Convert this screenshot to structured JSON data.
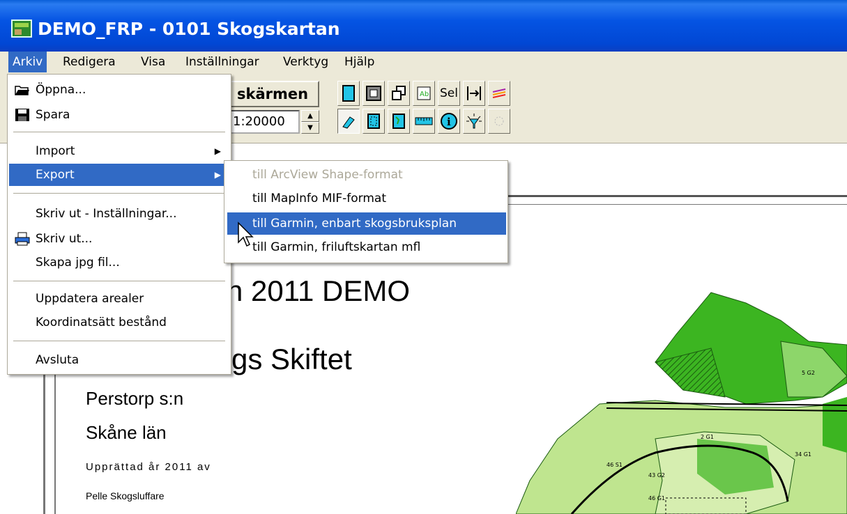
{
  "window": {
    "title": "DEMO_FRP - 0101 Skogskartan"
  },
  "menubar": {
    "items": [
      {
        "label": "Arkiv"
      },
      {
        "label": "Redigera"
      },
      {
        "label": "Visa"
      },
      {
        "label": "Inställningar"
      },
      {
        "label": "Verktyg"
      },
      {
        "label": "Hjälp"
      }
    ]
  },
  "toolbar": {
    "big_button_label": "skärmen",
    "scale_value": "1:20000",
    "sel_label": "Sel"
  },
  "arkiv_menu": {
    "items": [
      {
        "label": "Öppna..."
      },
      {
        "label": "Spara"
      },
      {
        "label": "Import"
      },
      {
        "label": "Export"
      },
      {
        "label": "Skriv ut - Inställningar..."
      },
      {
        "label": "Skriv ut..."
      },
      {
        "label": "Skapa jpg fil..."
      },
      {
        "label": "Uppdatera arealer"
      },
      {
        "label": "Koordinatsätt bestånd"
      },
      {
        "label": "Avsluta"
      }
    ]
  },
  "export_submenu": {
    "items": [
      {
        "label": "till ArcView Shape-format"
      },
      {
        "label": "till MapInfo MIF-format"
      },
      {
        "label": "till Garmin, enbart skogsbruksplan"
      },
      {
        "label": "till Garmin, friluftskartan mfl"
      }
    ]
  },
  "map": {
    "heading1": "n 2011 DEMO",
    "heading2": "gs Skiftet",
    "parish": "Perstorp s:n",
    "county": "Skåne län",
    "prepared": "Upprättad år 2011 av",
    "author": "Pelle Skogsluffare"
  },
  "colors": {
    "titlebar": "#0554e3",
    "highlight": "#316ac5",
    "forest_dark": "#3cb521",
    "forest_light": "#bfe58f"
  }
}
